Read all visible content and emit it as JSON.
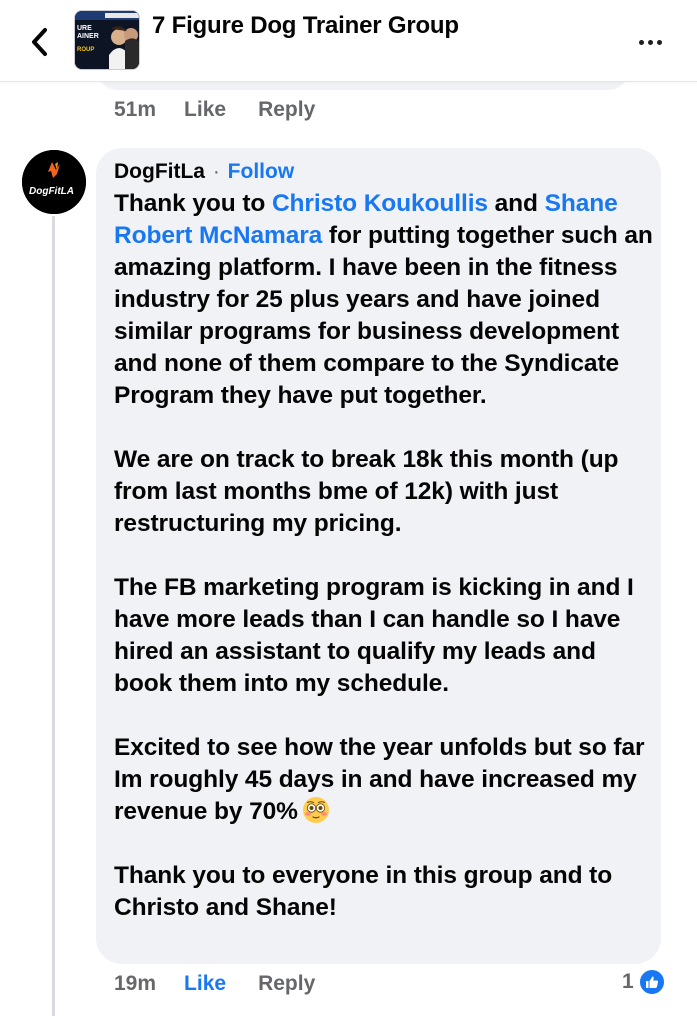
{
  "header": {
    "back_icon": "chevron-left-icon",
    "group_title": "7 Figure Dog Trainer Group",
    "thumbnail_text_line1": "URE",
    "thumbnail_text_line2": "AINER",
    "thumbnail_text_line3": "ROUP",
    "more_icon": "more-horizontal-icon"
  },
  "previous_comment": {
    "timestamp": "51m",
    "like_label": "Like",
    "reply_label": "Reply"
  },
  "comment": {
    "author": "DogFitLa",
    "separator": "·",
    "follow_label": "Follow",
    "avatar_logo_text": "DogFitLA",
    "paragraph1": {
      "prefix": "Thank you to ",
      "mention1": "Christo Koukoullis",
      "middle": " and ",
      "mention2": "Shane Robert McNamara",
      "suffix": " for putting together such an amazing platform. I have been in the fitness industry for 25 plus years and have joined similar programs for business development and none of them compare to the Syndicate Program they have put together."
    },
    "paragraph2": "We are on track to break 18k this month (up from last months bme of 12k) with just restructuring my pricing.",
    "paragraph3": "The FB marketing program is kicking in and I have more leads than I can handle so I have hired an assistant to qualify my leads and book them into my schedule.",
    "paragraph4": "Excited to see how the year unfolds but so far Im roughly 45 days in and have increased my revenue by 70%",
    "paragraph4_emoji": "flushed-face-emoji",
    "paragraph5": "Thank you to everyone in this group and to Christo and Shane!",
    "timestamp": "19m",
    "like_label": "Like",
    "reply_label": "Reply",
    "reaction_count": "1",
    "reaction_icon": "thumbs-up-icon"
  },
  "colors": {
    "accent": "#1877f2",
    "bubble": "#f0f2f5",
    "secondary_text": "#65676b"
  }
}
